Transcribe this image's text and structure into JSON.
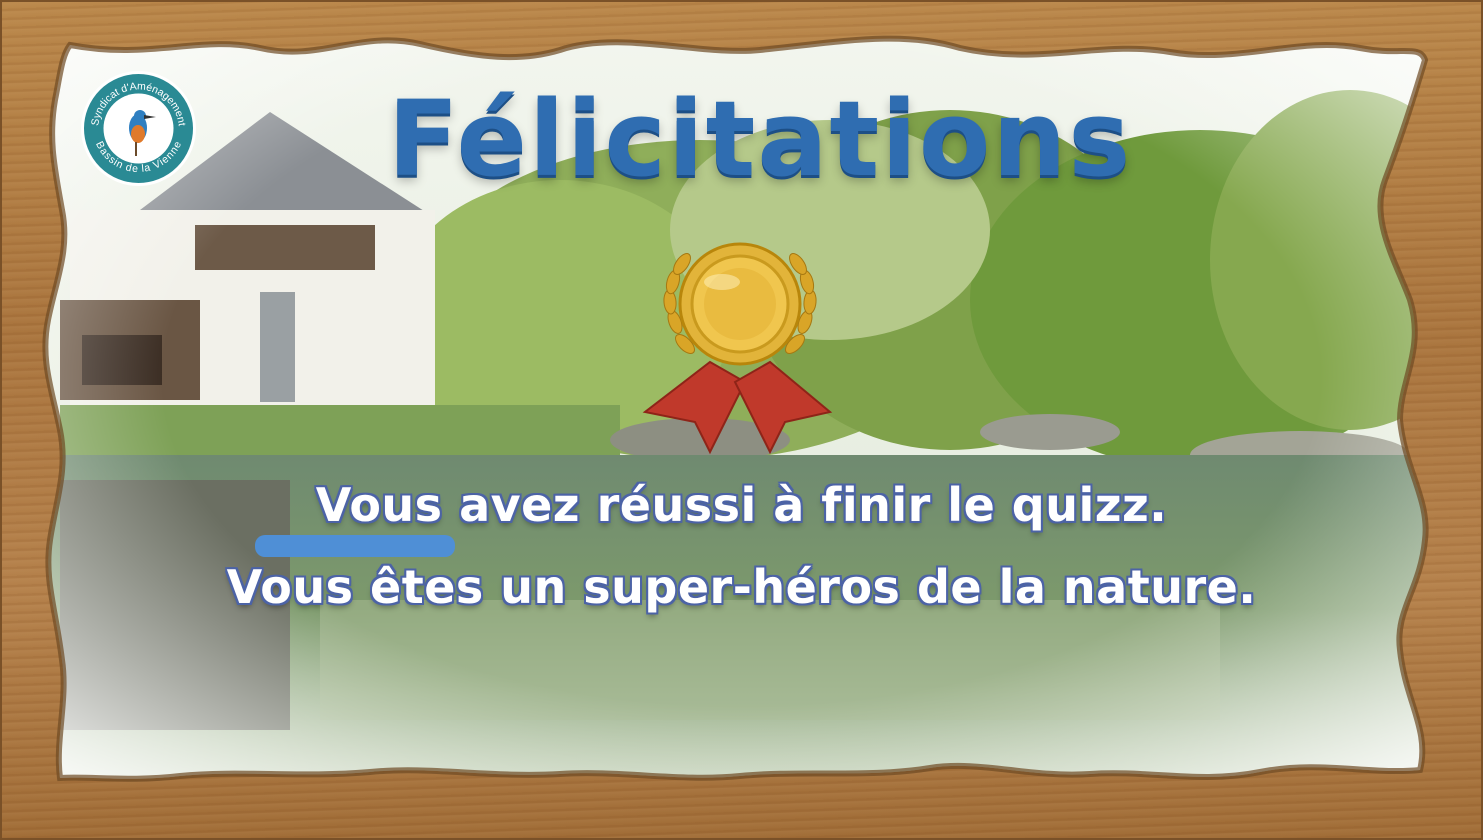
{
  "title": "Félicitations",
  "messages": {
    "line1": "Vous avez réussi à finir le quizz.",
    "line2": "Vous êtes un super-héros de la nature."
  },
  "logo": {
    "text_top": "Syndicat d'Aménagement",
    "text_bottom": "Bassin de la Vienne",
    "icon": "kingfisher-icon"
  },
  "medal": {
    "icon": "gold-medal-icon"
  },
  "colors": {
    "title": "#2f6db1",
    "wood": "#b07a43",
    "logo_ring": "#2a8a94",
    "text_outline": "#4c63a6",
    "medal_gold": "#e2b43a",
    "ribbon": "#c0392b"
  }
}
